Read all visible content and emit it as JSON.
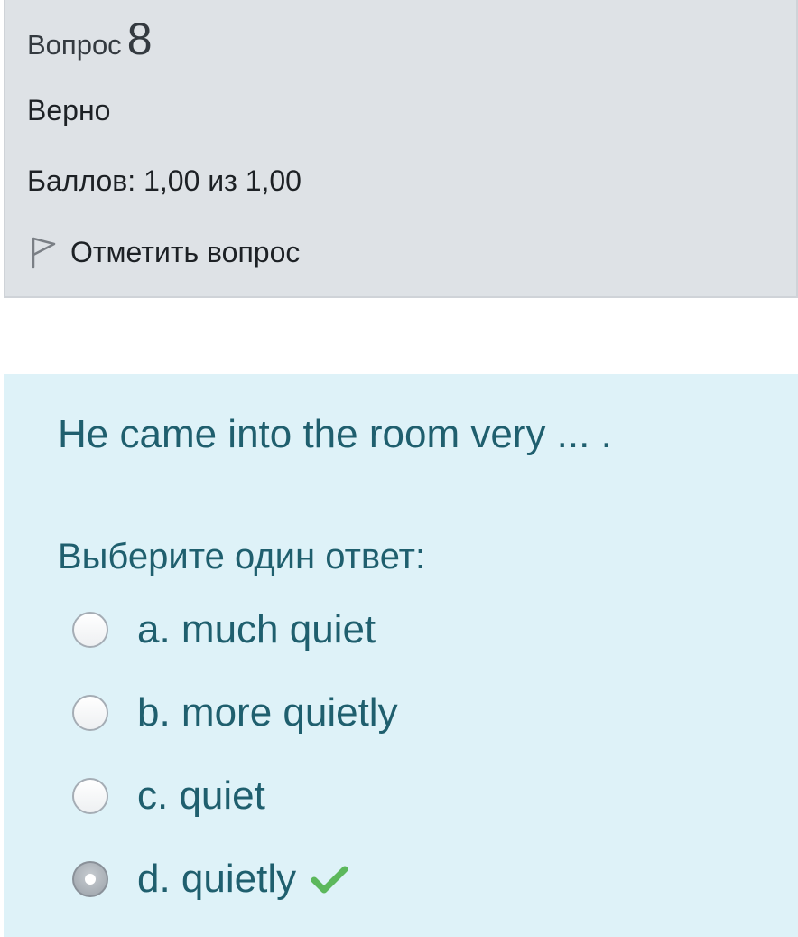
{
  "info": {
    "question_label": "Вопрос",
    "question_number": "8",
    "state": "Верно",
    "grade": "Баллов: 1,00 из 1,00",
    "flag_label": "Отметить вопрос"
  },
  "question": {
    "text": "He came into the room very ... .",
    "prompt": "Выберите один ответ:",
    "answers": [
      {
        "label": "a. much quiet",
        "selected": false
      },
      {
        "label": "b. more quietly",
        "selected": false
      },
      {
        "label": "c. quiet",
        "selected": false
      },
      {
        "label": "d. quietly",
        "selected": true,
        "correct": true
      }
    ]
  },
  "colors": {
    "info_background": "#dee2e6",
    "question_background": "#def2f8",
    "question_text": "#1f5f6e",
    "correct_check": "#5cb85c"
  },
  "icons": {
    "flag": "flag-icon",
    "correct": "check-icon"
  }
}
